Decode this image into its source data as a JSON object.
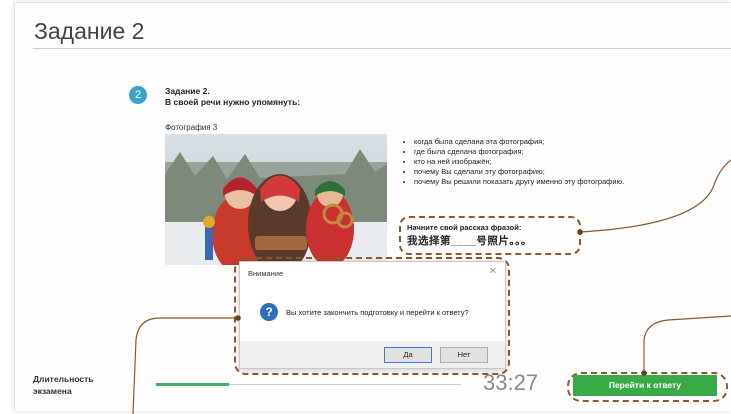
{
  "page": {
    "title": "Задание 2"
  },
  "task": {
    "number": "2",
    "heading_line1": "Задание 2.",
    "heading_line2": "В своей речи нужно упомянуть:",
    "photo_label": "Фотография 3",
    "bullets": [
      "когда была сделана эта фотография;",
      "где была сделана фотография;",
      "кто на ней изображён;",
      "почему Вы сделали эту фотографию;",
      "почему Вы решили показать другу именно эту фотографию."
    ],
    "phrase_title": "Начните свой рассказ фразой:",
    "phrase_text": "我选择第____号照片。。。"
  },
  "dialog": {
    "title": "Внимание",
    "message": "Вы хотите закончить подготовку и перейти к ответу?",
    "yes_label": "Да",
    "no_label": "Нет",
    "icon": "question-icon"
  },
  "footer": {
    "duration_line1": "Длительность",
    "duration_line2": "экзамена",
    "timer": "33:27",
    "progress_fraction": 0.24,
    "answer_button": "Перейти к ответу"
  },
  "colors": {
    "accent_blue": "#3aa3c9",
    "button_green": "#3aaa47",
    "progress_green": "#3eb06a",
    "callout_brown": "#8b5a2b"
  }
}
